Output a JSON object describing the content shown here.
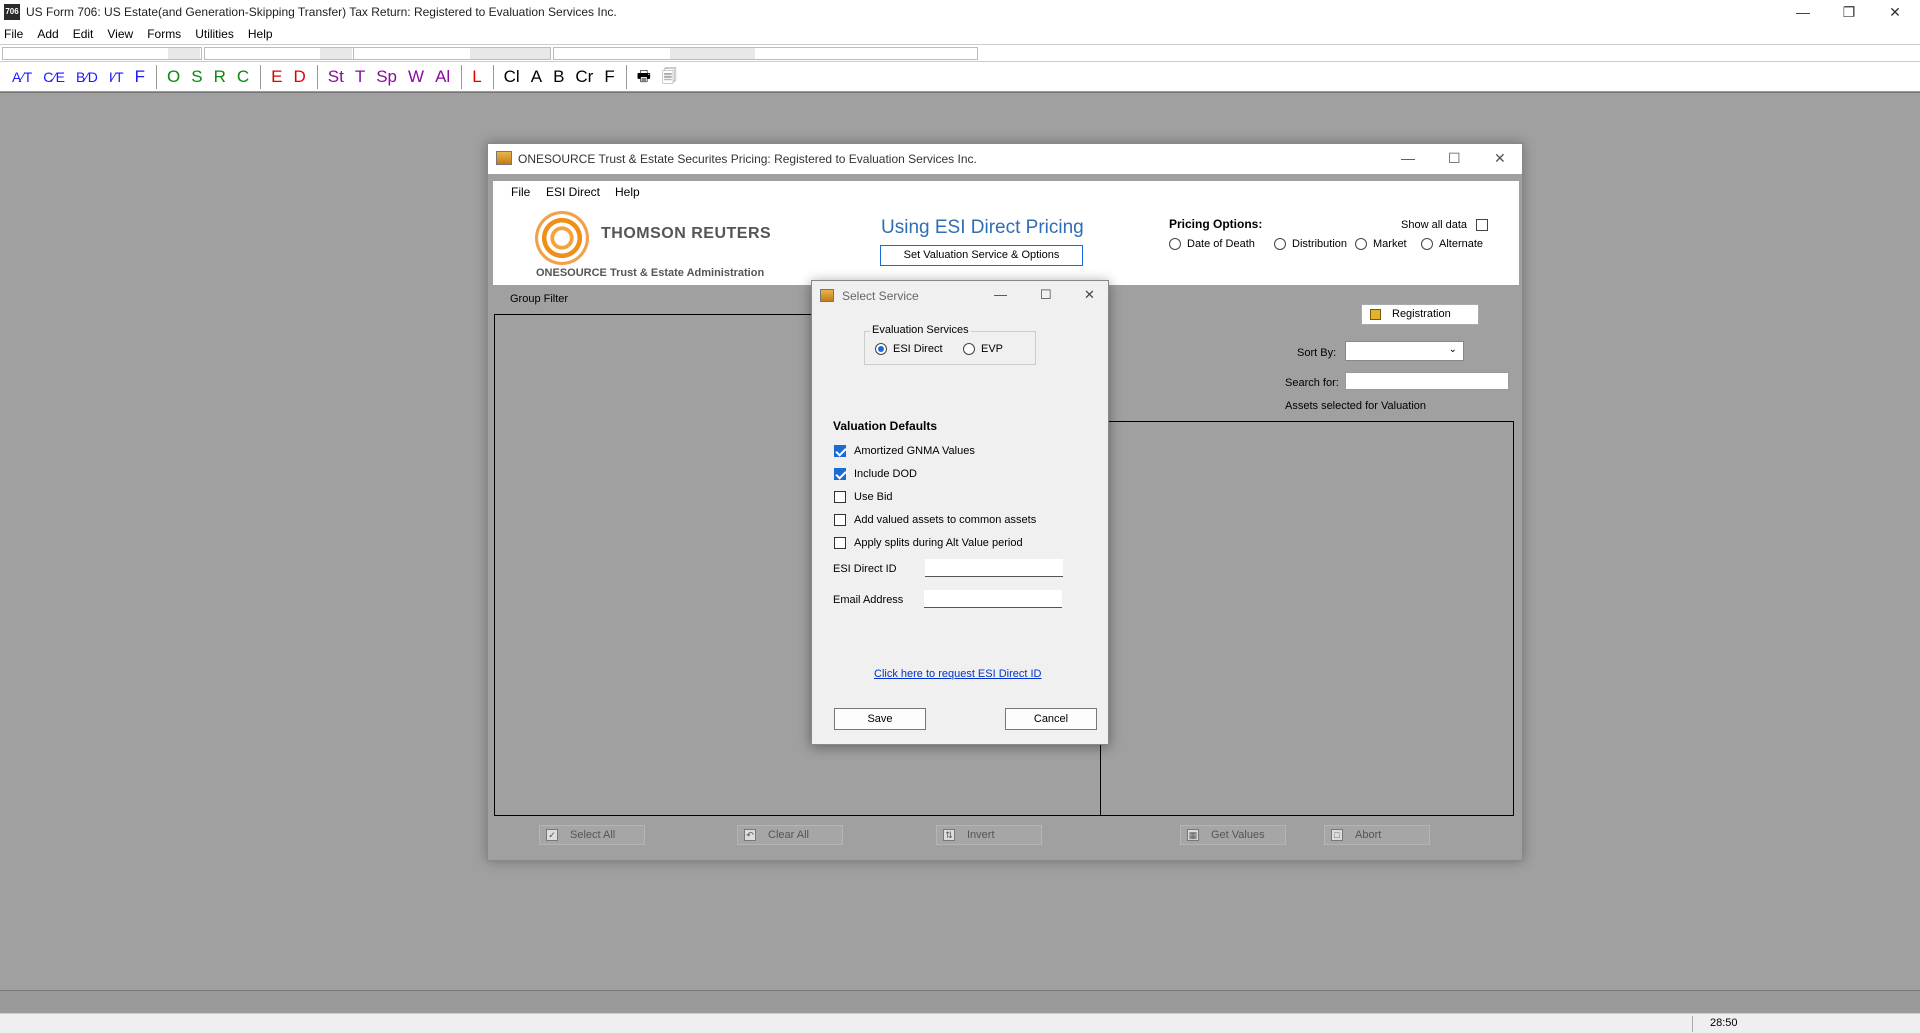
{
  "app": {
    "title": "US Form 706: US Estate(and Generation-Skipping Transfer) Tax Return: Registered to Evaluation Services Inc.",
    "icon_text": "706",
    "menu": [
      "File",
      "Add",
      "Edit",
      "View",
      "Forms",
      "Utilities",
      "Help"
    ],
    "toolbar": [
      "A⁄T",
      "C⁄E",
      "B⁄D",
      "I⁄T",
      "F",
      "O",
      "S",
      "R",
      "C",
      "E",
      "D",
      "St",
      "T",
      "Sp",
      "W",
      "Al",
      "L",
      "Cl",
      "A",
      "B",
      "Cr",
      "F"
    ],
    "toolbar_colors": {
      "blue": "#1a1aff",
      "green": "#0a8a0a",
      "red": "#e00000",
      "purple": "#8a0aa0",
      "black": "#000000"
    },
    "status_time": "28:50"
  },
  "pricing": {
    "title": "ONESOURCE Trust & Estate Securites Pricing: Registered to Evaluation Services Inc.",
    "menu": [
      "File",
      "ESI Direct",
      "Help"
    ],
    "logo_text": "THOMSON REUTERS",
    "logo_sub": "ONESOURCE Trust & Estate Administration",
    "heading": "Using ESI Direct Pricing",
    "set_button": "Set Valuation Service & Options",
    "pricing_options_label": "Pricing Options:",
    "show_all_label": "Show all data",
    "options": [
      "Date of Death",
      "Distribution",
      "Market",
      "Alternate"
    ],
    "group_filter": "Group Filter",
    "registration": "Registration",
    "sort_by": "Sort By:",
    "search_for": "Search for:",
    "assets_selected": "Assets selected for Valuation",
    "bottom_buttons": [
      "Select All",
      "Clear All",
      "Invert",
      "Get Values",
      "Abort"
    ],
    "accent": "#2f6db5"
  },
  "dialog": {
    "title": "Select Service",
    "eval_label": "Evaluation Services",
    "service_options": [
      "ESI Direct",
      "EVP"
    ],
    "selected_service": "ESI Direct",
    "defaults_label": "Valuation Defaults",
    "checkboxes": [
      {
        "label": "Amortized GNMA Values",
        "checked": true
      },
      {
        "label": "Include DOD",
        "checked": true
      },
      {
        "label": "Use Bid",
        "checked": false
      },
      {
        "label": "Add valued assets to common assets",
        "checked": false
      },
      {
        "label": "Apply splits during Alt Value period",
        "checked": false
      }
    ],
    "esi_id_label": "ESI Direct ID",
    "esi_id_value": "",
    "email_label": "Email Address",
    "email_value": "",
    "request_link": "Click here to request ESI Direct ID",
    "save": "Save",
    "cancel": "Cancel"
  }
}
